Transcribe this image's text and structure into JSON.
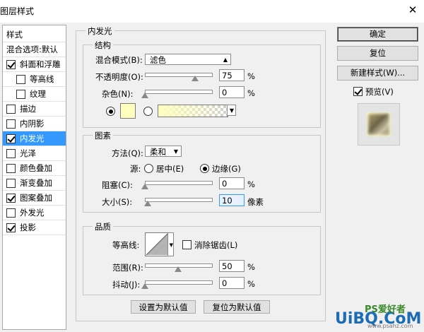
{
  "window": {
    "title": "图层样式",
    "close_glyph": "✕"
  },
  "left_panel": {
    "items": [
      {
        "label": "样式",
        "checked": null,
        "selected": false
      },
      {
        "label": "混合选项:默认",
        "checked": null,
        "selected": false
      },
      {
        "label": "斜面和浮雕",
        "checked": true,
        "selected": false
      },
      {
        "label": "等高线",
        "checked": false,
        "selected": false
      },
      {
        "label": "纹理",
        "checked": false,
        "selected": false
      },
      {
        "label": "描边",
        "checked": false,
        "selected": false
      },
      {
        "label": "内阴影",
        "checked": false,
        "selected": false
      },
      {
        "label": "内发光",
        "checked": true,
        "selected": true
      },
      {
        "label": "光泽",
        "checked": false,
        "selected": false
      },
      {
        "label": "颜色叠加",
        "checked": false,
        "selected": false
      },
      {
        "label": "渐变叠加",
        "checked": false,
        "selected": false
      },
      {
        "label": "图案叠加",
        "checked": true,
        "selected": false
      },
      {
        "label": "外发光",
        "checked": false,
        "selected": false
      },
      {
        "label": "投影",
        "checked": true,
        "selected": false
      }
    ]
  },
  "main": {
    "section_title": "内发光",
    "structure": {
      "title": "结构",
      "blend_mode_label": "混合模式(B):",
      "blend_mode_value": "滤色",
      "opacity_label": "不透明度(O):",
      "opacity_value": "75",
      "opacity_level": 0.75,
      "noise_label": "杂色(N):",
      "noise_value": "0",
      "noise_level": 0,
      "percent": "%",
      "solid_color": "#ffffbe",
      "gradient_colors": [
        "#ffffbe",
        "#ffffff"
      ]
    },
    "elements": {
      "title": "图素",
      "method_label": "方法(Q):",
      "method_value": "柔和",
      "source_label": "源:",
      "source_center": "居中(E)",
      "source_edge": "边缘(G)",
      "choke_label": "阻塞(C):",
      "choke_value": "0",
      "choke_level": 0,
      "size_label": "大小(S):",
      "size_value": "10",
      "size_level": 0.04,
      "size_unit": "像素",
      "percent": "%"
    },
    "quality": {
      "title": "品质",
      "contour_label": "等高线:",
      "antialias_label": "消除锯齿(L)",
      "range_label": "范围(R):",
      "range_value": "50",
      "range_level": 0.5,
      "jitter_label": "抖动(J):",
      "jitter_value": "0",
      "jitter_level": 0,
      "percent": "%"
    },
    "make_default": "设置为默认值",
    "reset_default": "复位为默认值"
  },
  "right_panel": {
    "ok": "确定",
    "reset": "复位",
    "new_style": "新建样式(W)...",
    "preview_label": "预览(V)"
  },
  "watermark": {
    "text1": "UiBQ.CoM",
    "text2": "PS爱好者",
    "text3": "www.psahz.com"
  }
}
